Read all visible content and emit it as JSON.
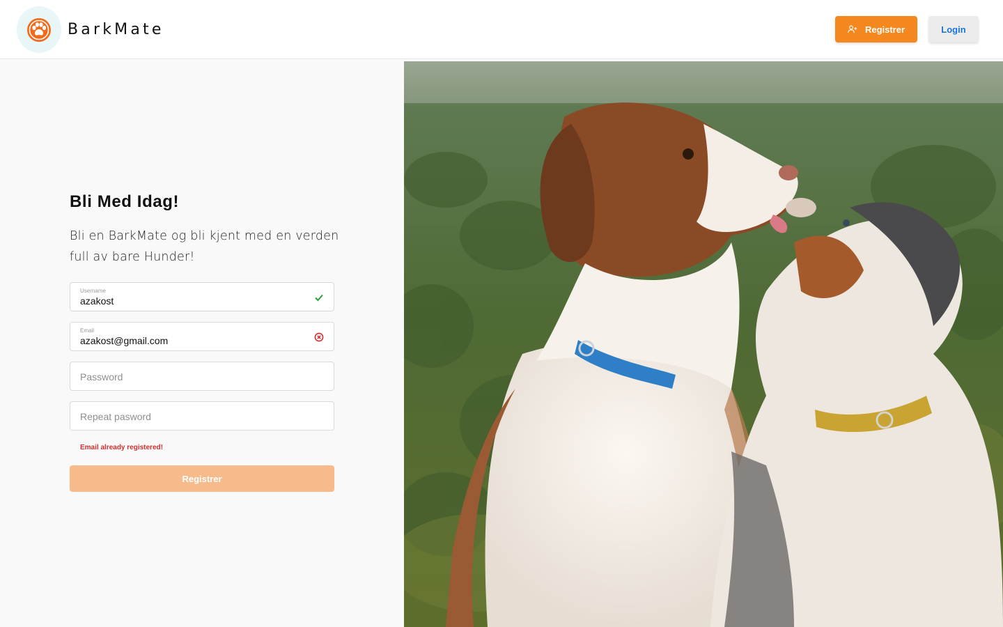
{
  "header": {
    "brand_name": "BarkMate",
    "register_label": "Registrer",
    "login_label": "Login"
  },
  "form": {
    "title": "Bli Med Idag!",
    "subtitle": "Bli en BarkMate og bli kjent med en verden full av bare Hunder!",
    "username": {
      "label": "Username",
      "value": "azakost",
      "status": "valid"
    },
    "email": {
      "label": "Email",
      "value": "azakost@gmail.com",
      "status": "error"
    },
    "password": {
      "placeholder": "Password"
    },
    "repeat_password": {
      "placeholder": "Repeat pasword"
    },
    "error_message": "Email already registered!",
    "submit_label": "Registrer"
  },
  "colors": {
    "accent": "#f5871f",
    "accent_disabled": "#f7bb8b",
    "link_blue": "#1976d2",
    "success": "#2e9c3a",
    "error": "#d32f2f"
  },
  "icons": {
    "logo": "paw-icon",
    "register": "person-add-icon",
    "valid": "check-icon",
    "invalid": "error-circle-icon"
  }
}
